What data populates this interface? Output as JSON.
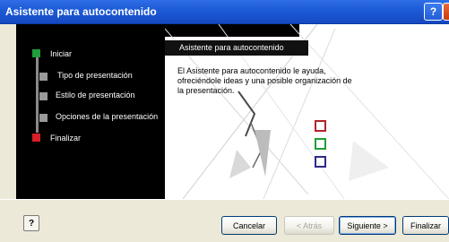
{
  "window": {
    "title": "Asistente para autocontenido",
    "help_glyph": "?",
    "close_glyph": "X"
  },
  "steps": [
    {
      "label": "Iniciar",
      "color": "#1f9e3a"
    },
    {
      "label": "Tipo de presentación",
      "color": "#9a9a9a"
    },
    {
      "label": "Estilo de presentación",
      "color": "#9a9a9a"
    },
    {
      "label": "Opciones de la presentación",
      "color": "#9a9a9a"
    },
    {
      "label": "Finalizar",
      "color": "#d61f26"
    }
  ],
  "content": {
    "header": "Asistente para autocontenido",
    "body": "El Asistente para autocontenido le ayuda, ofreciéndole ideas y una posible organización de la presentación."
  },
  "decor_squares": [
    {
      "color": "#b1252c"
    },
    {
      "color": "#1f9e3a"
    },
    {
      "color": "#2e2a86"
    }
  ],
  "buttons": {
    "help": "?",
    "cancel": "Cancelar",
    "back": "< Atrás",
    "next": "Siguiente >",
    "finish": "Finalizar"
  }
}
